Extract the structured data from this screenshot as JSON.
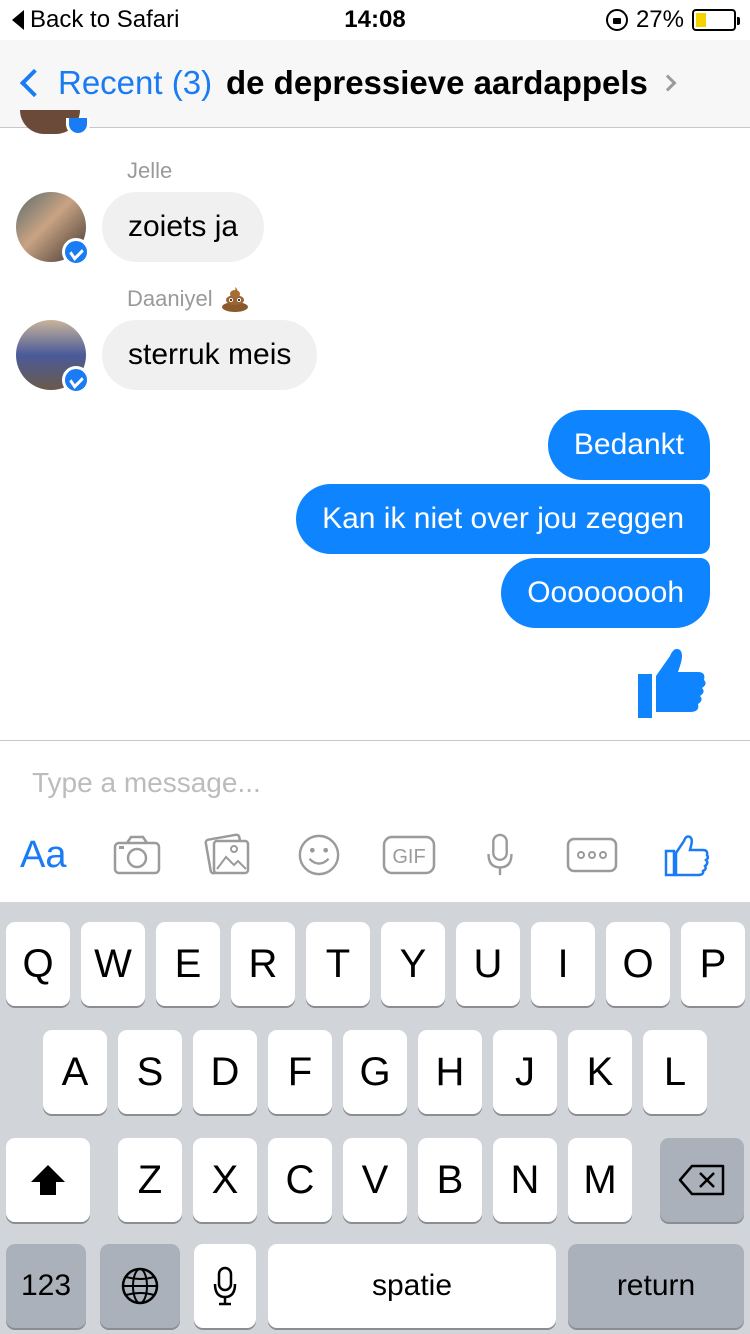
{
  "status_bar": {
    "back_label": "Back to Safari",
    "time": "14:08",
    "battery_percent": "27%",
    "battery_level": 0.27,
    "icons": [
      "lock-rotation-icon",
      "battery-icon"
    ]
  },
  "nav": {
    "back_label": "Recent (3)",
    "title": "de depressieve aardappels"
  },
  "messages": [
    {
      "sender": "Jelle",
      "text": "zoiets ja",
      "direction": "incoming"
    },
    {
      "sender": "Daaniyel",
      "sender_emoji": "poop-icon",
      "text": "sterruk meis",
      "direction": "incoming"
    },
    {
      "text": "Bedankt",
      "direction": "outgoing"
    },
    {
      "text": "Kan ik niet over jou zeggen",
      "direction": "outgoing"
    },
    {
      "text": "Ooooooooh",
      "direction": "outgoing"
    }
  ],
  "big_like_icon": "thumbs-up-icon",
  "composer": {
    "placeholder": "Type a message...",
    "aa_label": "Aa",
    "gif_label": "GIF",
    "toolbar_icons": [
      "text-format-icon",
      "camera-icon",
      "gallery-icon",
      "emoji-icon",
      "gif-icon",
      "microphone-icon",
      "more-icon",
      "thumbs-up-icon"
    ]
  },
  "keyboard": {
    "row1": [
      "Q",
      "W",
      "E",
      "R",
      "T",
      "Y",
      "U",
      "I",
      "O",
      "P"
    ],
    "row2": [
      "A",
      "S",
      "D",
      "F",
      "G",
      "H",
      "J",
      "K",
      "L"
    ],
    "row3": [
      "Z",
      "X",
      "C",
      "V",
      "B",
      "N",
      "M"
    ],
    "numbers_label": "123",
    "space_label": "spatie",
    "return_label": "return",
    "icons": [
      "shift-icon",
      "backspace-icon",
      "globe-icon",
      "dictation-mic-icon"
    ]
  },
  "colors": {
    "accent": "#1a7cf4",
    "outgoing_bubble": "#0f84ff",
    "incoming_bubble": "#f1f0f0",
    "keyboard_bg": "#d1d4d9",
    "battery": "#f5d100"
  }
}
